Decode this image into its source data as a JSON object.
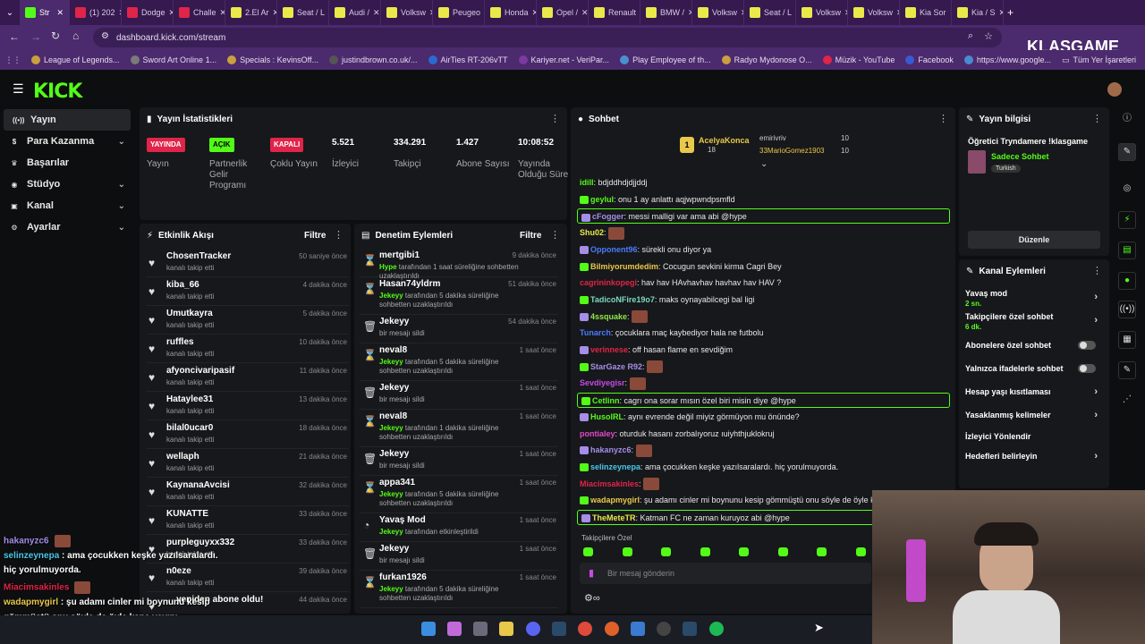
{
  "browser": {
    "tabs": [
      "Str",
      "(1) 202",
      "Dodge",
      "Challe",
      "2.El Ar",
      "Seat / L",
      "Audi / ",
      "Volksw",
      "Peugeo",
      "Honda",
      "Opel / ",
      "Renault",
      "BMW / ",
      "Volksw",
      "Seat / L",
      "Volksw",
      "Volksw",
      "Kia Sor",
      "Kia / S"
    ],
    "url": "dashboard.kick.com/stream",
    "bookmarks": [
      "League of Legends...",
      "Sword Art Online 1...",
      "Specials : KevinsOff...",
      "justindbrown.co.uk/...",
      "AirTies RT-206vTT",
      "Kariyer.net - VeriPar...",
      "Play Employee of th...",
      "Radyo Mydonose O...",
      "Müzik - YouTube",
      "Facebook",
      "https://www.google..."
    ],
    "bookmark_folder": "Tüm Yer İşaretleri",
    "watermark": "KLASGAME"
  },
  "nav": [
    "Yayın",
    "Para Kazanma",
    "Başarılar",
    "Stüdyo",
    "Kanal",
    "Ayarlar"
  ],
  "logo": "KICK",
  "stats": {
    "title": "Yayın İstatistikleri",
    "cols": [
      {
        "badge": "YAYINDA",
        "label": "Yayın"
      },
      {
        "badge": "AÇIK",
        "label": "Partnerlik Gelir Programı"
      },
      {
        "badge": "KAPALI",
        "label": "Çoklu Yayın"
      },
      {
        "value": "5.521",
        "label": "İzleyici"
      },
      {
        "value": "334.291",
        "label": "Takipçi"
      },
      {
        "value": "1.427",
        "label": "Abone Sayısı"
      },
      {
        "value": "10:08:52",
        "label": "Yayında Olduğu Süre"
      }
    ]
  },
  "activity": {
    "title": "Etkinlik Akışı",
    "filter": "Filtre",
    "items": [
      {
        "name": "ChosenTracker",
        "sub": "kanalı takip etti",
        "time": "50 saniye önce"
      },
      {
        "name": "kiba_66",
        "sub": "kanalı takip etti",
        "time": "4 dakika önce"
      },
      {
        "name": "Umutkayra",
        "sub": "kanalı takip etti",
        "time": "5 dakika önce"
      },
      {
        "name": "ruffles",
        "sub": "kanalı takip etti",
        "time": "10 dakika önce"
      },
      {
        "name": "afyoncivaripasif",
        "sub": "kanalı takip etti",
        "time": "11 dakika önce"
      },
      {
        "name": "Hataylee31",
        "sub": "kanalı takip etti",
        "time": "13 dakika önce"
      },
      {
        "name": "bilal0ucar0",
        "sub": "kanalı takip etti",
        "time": "18 dakika önce"
      },
      {
        "name": "wellaph",
        "sub": "kanalı takip etti",
        "time": "21 dakika önce"
      },
      {
        "name": "KaynanaAvcisi",
        "sub": "kanalı takip etti",
        "time": "32 dakika önce"
      },
      {
        "name": "KUNATTE",
        "sub": "kanalı takip etti",
        "time": "33 dakika önce"
      },
      {
        "name": "purpleguyxx332",
        "sub": "kanalı takip etti",
        "time": "33 dakika önce"
      },
      {
        "name": "n0eze",
        "sub": "kanalı takip etti",
        "time": "39 dakika önce"
      },
      {
        "name": "... yeniden abone oldu!",
        "sub": "",
        "time": "44 dakika önce"
      }
    ]
  },
  "moderation": {
    "title": "Denetim Eylemleri",
    "filter": "Filtre",
    "items": [
      {
        "icon": "⌛",
        "name": "mertgibi1",
        "by": "Hype",
        "sub": " tarafından 1 saat süreliğine sohbetten uzaklaştırıldı",
        "time": "9 dakika önce"
      },
      {
        "icon": "⌛",
        "name": "Hasan74yldrm",
        "by": "Jekeyy",
        "sub": " tarafından 5 dakika süreliğine sohbetten uzaklaştırıldı",
        "time": "51 dakika önce"
      },
      {
        "icon": "🗑",
        "name": "Jekeyy",
        "by": "",
        "sub": "bir mesajı sildi",
        "time": "54 dakika önce"
      },
      {
        "icon": "⌛",
        "name": "neval8",
        "by": "Jekeyy",
        "sub": " tarafından 5 dakika süreliğine sohbetten uzaklaştırıldı",
        "time": "1 saat önce"
      },
      {
        "icon": "🗑",
        "name": "Jekeyy",
        "by": "",
        "sub": "bir mesajı sildi",
        "time": "1 saat önce"
      },
      {
        "icon": "⌛",
        "name": "neval8",
        "by": "Jekeyy",
        "sub": " tarafından 1 dakika süreliğine sohbetten uzaklaştırıldı",
        "time": "1 saat önce"
      },
      {
        "icon": "🗑",
        "name": "Jekeyy",
        "by": "",
        "sub": "bir mesajı sildi",
        "time": "1 saat önce"
      },
      {
        "icon": "⌛",
        "name": "appa341",
        "by": "Jekeyy",
        "sub": " tarafından 5 dakika süreliğine sohbetten uzaklaştırıldı",
        "time": "1 saat önce"
      },
      {
        "icon": "◔",
        "name": "Yavaş Mod",
        "by": "Jekeyy",
        "sub": " tarafından etkinleştirildi",
        "time": "1 saat önce"
      },
      {
        "icon": "🗑",
        "name": "Jekeyy",
        "by": "",
        "sub": "bir mesajı sildi",
        "time": "1 saat önce"
      },
      {
        "icon": "⌛",
        "name": "furkan1926",
        "by": "Jekeyy",
        "sub": " tarafından 5 dakika süreliğine sohbetten uzaklaştırıldı",
        "time": "1 saat önce"
      }
    ]
  },
  "chat": {
    "title": "Sohbet",
    "top": [
      {
        "name": "AcelyaKonca",
        "n": "18"
      },
      {
        "name": "emirivriv",
        "n": "10"
      },
      {
        "name": "33MarioGomez1903",
        "n": "10"
      }
    ],
    "messages": [
      {
        "u": "idill",
        "c": "#53fc18",
        "t": "bdjddhdjdjjddj"
      },
      {
        "u": "geylul",
        "c": "#53fc18",
        "t": "onu 1 ay anlattı aqjwpwndpsmfld"
      },
      {
        "u": "cFogger",
        "c": "#a48ee8",
        "t": "messi malligi var ama abi @hype",
        "hl": true
      },
      {
        "u": "Shu02",
        "c": "#e9e94a",
        "t": "",
        "emo": true
      },
      {
        "u": "Opponent96",
        "c": "#4a7cff",
        "t": "sürekli onu diyor ya"
      },
      {
        "u": "Bilmiyorumdedim",
        "c": "#e9c84a",
        "t": "Cocugun sevkini kirma Cagri Bey"
      },
      {
        "u": "cagrininkopegi",
        "c": "#e0244a",
        "t": "hav hav HAvhavhav havhav hav HAV ?"
      },
      {
        "u": "TadicoNFire19o7",
        "c": "#7ad9c0",
        "t": "maks oynayabilcegi bal ligi"
      },
      {
        "u": "4ssquake",
        "c": "#8ee84a",
        "t": "",
        "emo": true
      },
      {
        "u": "Tunarch",
        "c": "#4a7cff",
        "t": "çocuklara maç kaybediyor hala ne futbolu"
      },
      {
        "u": "verinnese",
        "c": "#e0244a",
        "t": "off hasan flame en sevdiğim"
      },
      {
        "u": "StarGaze R92",
        "c": "#a48ee8",
        "t": "",
        "emo": true
      },
      {
        "u": "Sevdiyegisr",
        "c": "#c74ae8",
        "t": "",
        "emo": true
      },
      {
        "u": "Cetlinn",
        "c": "#53fc18",
        "t": "cagrı ona sorar mısın özel biri misin diye @hype",
        "hl": true
      },
      {
        "u": "HusolRL",
        "c": "#53fc18",
        "t": "aynı evrende değil miyiz görmüyon mu önünde?"
      },
      {
        "u": "pontialey",
        "c": "#e04ac8",
        "t": "oturduk hasanı zorbalıyoruz ıuiyhthjuklokruj"
      },
      {
        "u": "hakanyzc6",
        "c": "#a48ee8",
        "t": "",
        "emo": true
      },
      {
        "u": "selinzeynepa",
        "c": "#4ac8e8",
        "t": "ama çocukken keşke yazılsaralardı. hiç yorulmuyorda."
      },
      {
        "u": "Miacimsakinles",
        "c": "#e0244a",
        "t": "",
        "emo": true
      },
      {
        "u": "wadapmygirl",
        "c": "#e9c84a",
        "t": "şu adamı cinler mi boynunu kesip gömmüştü onu söyle de öyle kapa yayını"
      },
      {
        "u": "TheMeteTR",
        "c": "#e9e94a",
        "t": "Katman FC ne zaman kuruyoz abi @hype",
        "hl": true
      }
    ],
    "followers_label": "Takipçilere Özel",
    "placeholder": "Bir mesaj gönderin"
  },
  "info": {
    "title": "Yayın bilgisi",
    "stream_title": "Öğretici Tryndamere !klasgame",
    "category": "Sadece Sohbet",
    "language": "Turkish",
    "edit": "Düzenle"
  },
  "channel_actions": {
    "title": "Kanal Eylemleri",
    "items": [
      {
        "label": "Yavaş mod",
        "sub": "2 sn.",
        "kind": "chev"
      },
      {
        "label": "Takipçilere özel sohbet",
        "sub": "6 dk.",
        "kind": "chev"
      },
      {
        "label": "Abonelere özel sohbet",
        "sub": "",
        "kind": "toggle"
      },
      {
        "label": "Yalnızca ifadelerle sohbet",
        "sub": "",
        "kind": "toggle"
      },
      {
        "label": "Hesap yaşı kısıtlaması",
        "sub": "",
        "kind": "chev"
      },
      {
        "label": "Yasaklanmış kelimeler",
        "sub": "",
        "kind": "chev"
      },
      {
        "label": "İzleyici Yönlendir",
        "sub": "",
        "kind": "none"
      },
      {
        "label": "Hedefleri belirleyin",
        "sub": "",
        "kind": "chev"
      }
    ]
  },
  "overlay": [
    {
      "u": "hakanyzc6",
      "c": "#a48ee8",
      "t": ""
    },
    {
      "u": "selinzeynepa",
      "c": "#4ac8e8",
      "t": " : ama çocukken keşke yazılsaralardı."
    },
    {
      "u": "",
      "c": "#fff",
      "t": "hiç yorulmuyorda."
    },
    {
      "u": "Miacimsakinles",
      "c": "#e0244a",
      "t": ""
    },
    {
      "u": "wadapmygirl",
      "c": "#e9c84a",
      "t": " : şu adamı cinler mi boynunu kesip"
    },
    {
      "u": "",
      "c": "#fff",
      "t": "gömmüştü onu söyle de öyle kapa yayını"
    },
    {
      "u": "heMeteTR",
      "c": "#e9e94a",
      "t": " : Katman FC ne zaman kuruyoz abi @hype"
    }
  ]
}
